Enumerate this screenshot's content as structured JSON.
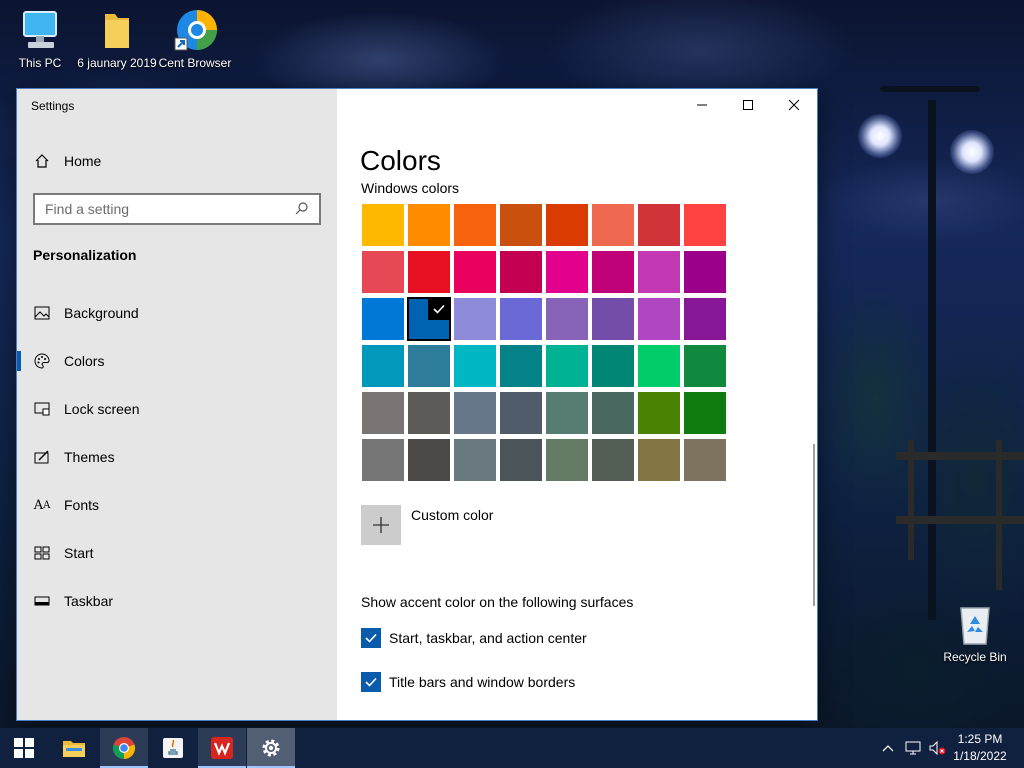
{
  "desktop": {
    "icons": [
      {
        "label": "This PC",
        "icon": "computer-icon"
      },
      {
        "label": "6 jaunary 2019",
        "icon": "folder-icon"
      },
      {
        "label": "Cent Browser",
        "icon": "cent-browser-icon"
      },
      {
        "label": "Recycle Bin",
        "icon": "recycle-bin-icon"
      }
    ]
  },
  "window": {
    "title": "Settings",
    "controls": {
      "minimize": "minimize-icon",
      "maximize": "maximize-icon",
      "close": "close-icon"
    }
  },
  "sidebar": {
    "home_label": "Home",
    "search_placeholder": "Find a setting",
    "section_title": "Personalization",
    "items": [
      {
        "label": "Background",
        "icon": "picture-icon",
        "active": false
      },
      {
        "label": "Colors",
        "icon": "palette-icon",
        "active": true
      },
      {
        "label": "Lock screen",
        "icon": "lock-screen-icon",
        "active": false
      },
      {
        "label": "Themes",
        "icon": "themes-icon",
        "active": false
      },
      {
        "label": "Fonts",
        "icon": "fonts-icon",
        "active": false
      },
      {
        "label": "Start",
        "icon": "start-icon",
        "active": false
      },
      {
        "label": "Taskbar",
        "icon": "taskbar-icon",
        "active": false
      }
    ]
  },
  "main": {
    "title": "Colors",
    "subtitle": "Windows colors",
    "selected_swatch": 17,
    "swatches": [
      "#FFB900",
      "#FF8C00",
      "#F7630C",
      "#CA5010",
      "#DA3B01",
      "#EF6950",
      "#D13438",
      "#FF4343",
      "#E74856",
      "#E81123",
      "#EA005E",
      "#C30052",
      "#E3008C",
      "#BF0077",
      "#C239B3",
      "#9A0089",
      "#0078D7",
      "#0063B1",
      "#8E8CD8",
      "#6B69D6",
      "#8764B8",
      "#744DA9",
      "#B146C2",
      "#881798",
      "#0099BC",
      "#2D7D9A",
      "#00B7C3",
      "#038387",
      "#00B294",
      "#018574",
      "#00CC6A",
      "#10893E",
      "#7A7574",
      "#5D5A58",
      "#68768A",
      "#515C6B",
      "#567C73",
      "#486860",
      "#498205",
      "#107C10",
      "#767676",
      "#4C4A48",
      "#69797E",
      "#4A5459",
      "#647C64",
      "#525E54",
      "#847545",
      "#7E735F"
    ],
    "custom_color_label": "Custom color",
    "surfaces_label": "Show accent color on the following surfaces",
    "checkboxes": [
      {
        "label": "Start, taskbar, and action center",
        "checked": true
      },
      {
        "label": "Title bars and window borders",
        "checked": true
      }
    ]
  },
  "taskbar": {
    "apps": [
      {
        "name": "start-button",
        "icon": "windows-logo-icon",
        "state": "none"
      },
      {
        "name": "file-explorer",
        "icon": "folder-icon",
        "state": "none"
      },
      {
        "name": "chrome",
        "icon": "chrome-icon",
        "state": "open"
      },
      {
        "name": "java",
        "icon": "java-icon",
        "state": "none"
      },
      {
        "name": "wps-office",
        "icon": "wps-office-icon",
        "state": "open"
      },
      {
        "name": "settings",
        "icon": "gear-icon",
        "state": "active"
      }
    ],
    "tray_icons": [
      "chevron-up-icon",
      "network-icon",
      "volume-muted-icon"
    ],
    "time": "1:25 PM",
    "date": "1/18/2022"
  }
}
